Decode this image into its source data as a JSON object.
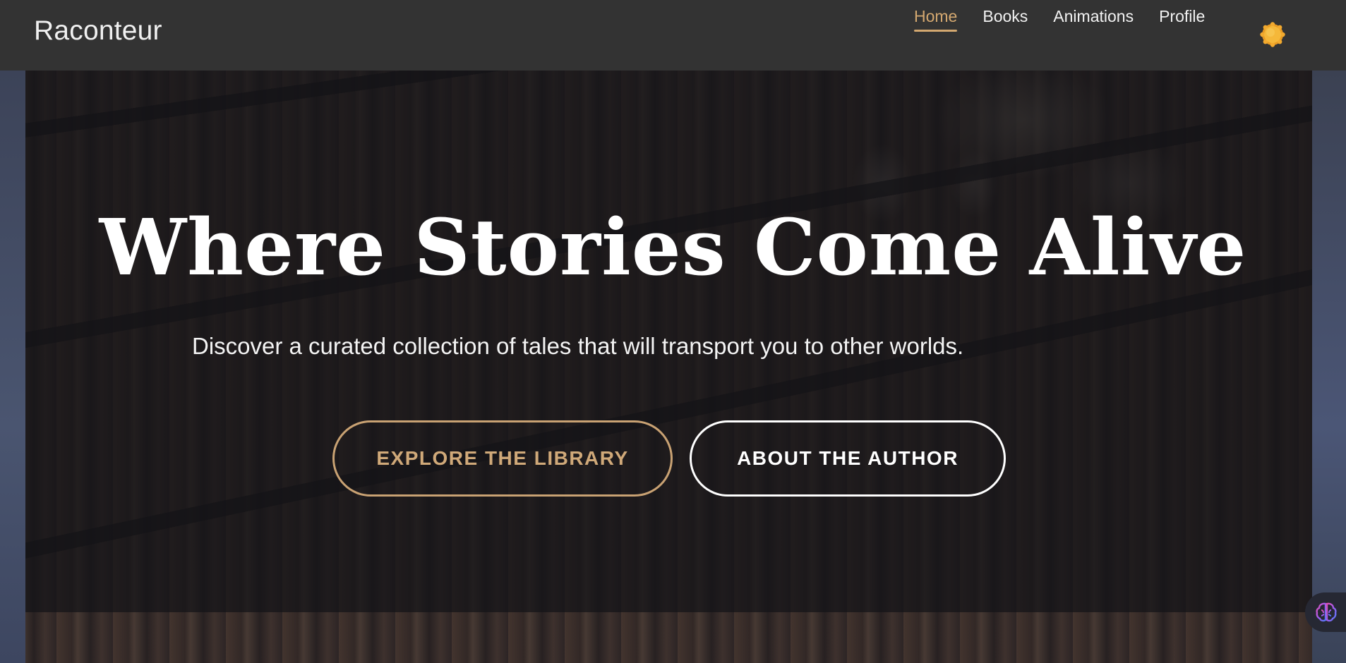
{
  "brand": {
    "name": "Raconteur"
  },
  "nav": {
    "items": [
      {
        "label": "Home",
        "active": true
      },
      {
        "label": "Books",
        "active": false
      },
      {
        "label": "Animations",
        "active": false
      },
      {
        "label": "Profile",
        "active": false
      }
    ],
    "theme_toggle_icon": "sun-icon"
  },
  "hero": {
    "title": "Where Stories Come Alive",
    "subtitle": "Discover a curated collection of tales that will transport you to other worlds.",
    "primary_button": "EXPLORE THE LIBRARY",
    "secondary_button": "ABOUT THE AUTHOR",
    "background_image": "blurred-library-bookshelves"
  },
  "assistant": {
    "icon": "brain-icon"
  },
  "colors": {
    "navbar_bg": "#333333",
    "accent_gold": "#d4a870",
    "text_white": "#ffffff",
    "hero_overlay": "#141418",
    "sun": "#f0a830"
  }
}
